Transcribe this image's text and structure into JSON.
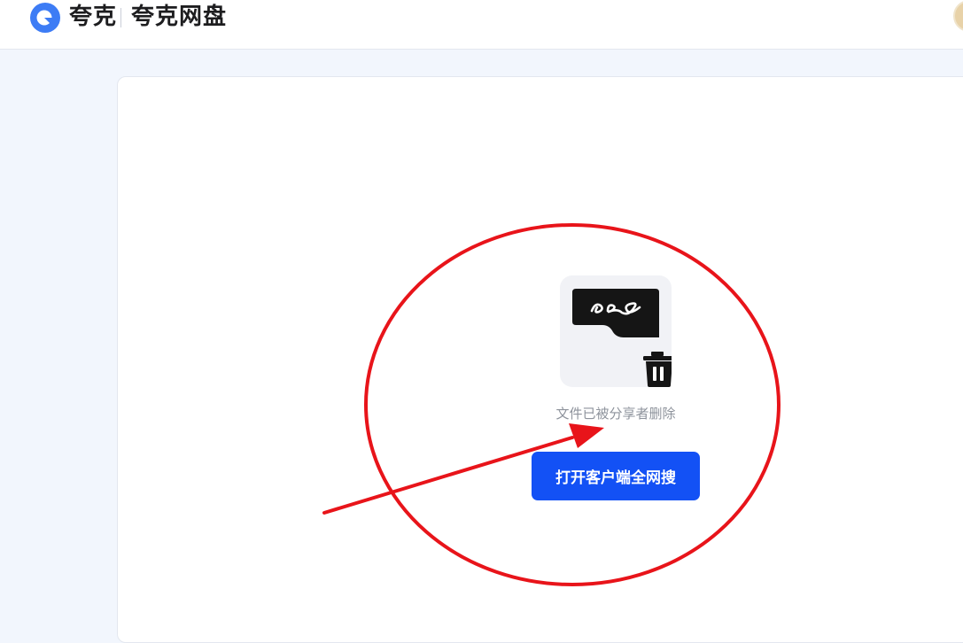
{
  "header": {
    "brand": "夸克",
    "product": "夸克网盘"
  },
  "main": {
    "message": "文件已被分享者删除",
    "open_button_label": "打开客户端全网搜"
  },
  "icons": {
    "logo": "quark-logo-icon",
    "file": "shared-file-icon",
    "trash": "trash-icon",
    "avatar": "user-avatar"
  },
  "colors": {
    "brand_blue": "#1351f5",
    "logo_blue": "#3d7cf5",
    "annotation_red": "#e8141a",
    "message_gray": "#8e939c"
  }
}
